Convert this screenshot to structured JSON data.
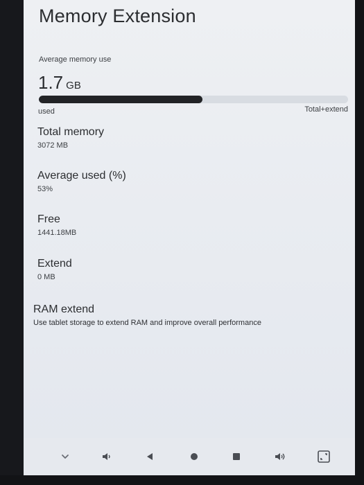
{
  "header": {
    "title": "Memory Extension"
  },
  "average": {
    "label": "Average memory use",
    "value": "1.7",
    "unit": "GB",
    "used_fraction": 0.53,
    "used_label": "used",
    "total_label": "Total+extend"
  },
  "stats": {
    "total_memory": {
      "title": "Total memory",
      "value": "3072 MB"
    },
    "average_used": {
      "title": "Average used (%)",
      "value": "53%"
    },
    "free": {
      "title": "Free",
      "value": "1441.18MB"
    },
    "extend": {
      "title": "Extend",
      "value": "0 MB"
    }
  },
  "ram_extend": {
    "title": "RAM extend",
    "description": "Use tablet storage to extend RAM and improve overall performance"
  },
  "nav": {
    "icons": [
      "chevron-down-icon",
      "volume-down-icon",
      "back-icon",
      "home-icon",
      "recents-icon",
      "volume-up-icon",
      "screenshot-icon"
    ]
  },
  "colors": {
    "background": "#eceef2",
    "text": "#2b2d30",
    "progress_fill": "#222326",
    "progress_track": "#d8dce2"
  }
}
